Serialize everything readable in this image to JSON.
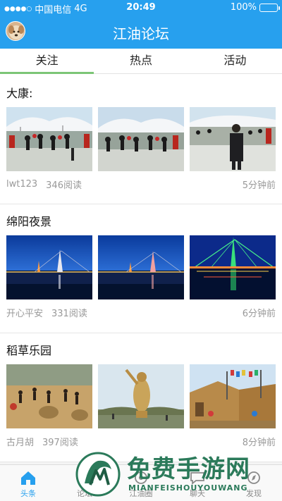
{
  "status_bar": {
    "carrier": "中国电信",
    "network": "4G",
    "time": "20:49",
    "battery": "100%"
  },
  "nav": {
    "title": "江油论坛"
  },
  "tabs": [
    {
      "label": "关注",
      "active": true
    },
    {
      "label": "热点",
      "active": false
    },
    {
      "label": "活动",
      "active": false
    }
  ],
  "posts": [
    {
      "title": "大康:",
      "author": "lwt123",
      "views": "346阅读",
      "time": "5分钟前"
    },
    {
      "title": "绵阳夜景",
      "author": "开心平安",
      "views": "331阅读",
      "time": "6分钟前"
    },
    {
      "title": "稻草乐园",
      "author": "古月胡",
      "views": "397阅读",
      "time": "8分钟前"
    }
  ],
  "bottom_tabs": [
    {
      "label": "头条",
      "icon": "home-icon",
      "active": true
    },
    {
      "label": "论坛",
      "icon": "forum-icon",
      "active": false
    },
    {
      "label": "江油圈",
      "icon": "circle-icon",
      "active": false
    },
    {
      "label": "聊天",
      "icon": "chat-icon",
      "active": false
    },
    {
      "label": "发现",
      "icon": "discover-icon",
      "active": false
    }
  ],
  "watermark": {
    "title": "免费手游网",
    "subtitle": "MIANFEISHOUYOUWANG"
  },
  "colors": {
    "brand": "#27a0ee",
    "tab_indicator": "#7cc576",
    "meta_text": "#999999",
    "watermark": "#2b7a5a"
  }
}
